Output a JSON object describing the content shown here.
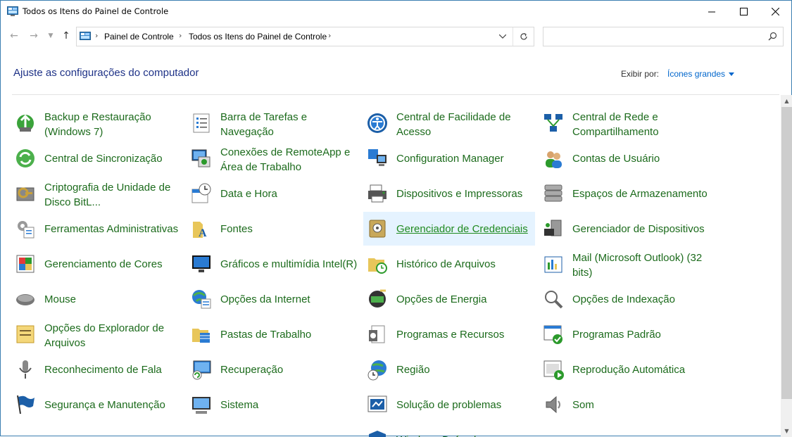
{
  "window": {
    "title": "Todos os Itens do Painel de Controle"
  },
  "address": {
    "crumbs": [
      "Painel de Controle",
      "Todos os Itens do Painel de Controle"
    ],
    "search_placeholder": ""
  },
  "header": {
    "title": "Ajuste as configurações do computador",
    "view_label": "Exibir por:",
    "view_value": "Ícones grandes"
  },
  "items": [
    {
      "label": "Backup e Restauração (Windows 7)",
      "icon": "backup-icon"
    },
    {
      "label": "Barra de Tarefas e Navegação",
      "icon": "taskbar-icon"
    },
    {
      "label": "Central de Facilidade de Acesso",
      "icon": "ease-of-access-icon"
    },
    {
      "label": "Central de Rede e Compartilhamento",
      "icon": "network-icon"
    },
    {
      "label": "Central de Sincronização",
      "icon": "sync-icon"
    },
    {
      "label": "Conexões de RemoteApp e Área de Trabalho",
      "icon": "remoteapp-icon"
    },
    {
      "label": "Configuration Manager",
      "icon": "config-manager-icon"
    },
    {
      "label": "Contas de Usuário",
      "icon": "users-icon"
    },
    {
      "label": "Criptografia de Unidade de Disco BitL...",
      "icon": "bitlocker-icon"
    },
    {
      "label": "Data e Hora",
      "icon": "clock-icon"
    },
    {
      "label": "Dispositivos e Impressoras",
      "icon": "printer-icon"
    },
    {
      "label": "Espaços de Armazenamento",
      "icon": "storage-icon"
    },
    {
      "label": "Ferramentas Administrativas",
      "icon": "admin-tools-icon"
    },
    {
      "label": "Fontes",
      "icon": "fonts-icon"
    },
    {
      "label": "Gerenciador de Credenciais",
      "icon": "credential-icon"
    },
    {
      "label": "Gerenciador de Dispositivos",
      "icon": "device-manager-icon"
    },
    {
      "label": "Gerenciamento de Cores",
      "icon": "color-icon"
    },
    {
      "label": "Gráficos e multimídia Intel(R)",
      "icon": "intel-graphics-icon"
    },
    {
      "label": "Histórico de Arquivos",
      "icon": "file-history-icon"
    },
    {
      "label": "Mail (Microsoft Outlook) (32 bits)",
      "icon": "mail-icon"
    },
    {
      "label": "Mouse",
      "icon": "mouse-icon"
    },
    {
      "label": "Opções da Internet",
      "icon": "internet-icon"
    },
    {
      "label": "Opções de Energia",
      "icon": "power-icon"
    },
    {
      "label": "Opções de Indexação",
      "icon": "indexing-icon"
    },
    {
      "label": "Opções do Explorador de Arquivos",
      "icon": "explorer-options-icon"
    },
    {
      "label": "Pastas de Trabalho",
      "icon": "work-folders-icon"
    },
    {
      "label": "Programas e Recursos",
      "icon": "programs-icon"
    },
    {
      "label": "Programas Padrão",
      "icon": "default-programs-icon"
    },
    {
      "label": "Reconhecimento de Fala",
      "icon": "microphone-icon"
    },
    {
      "label": "Recuperação",
      "icon": "recovery-icon"
    },
    {
      "label": "Região",
      "icon": "region-icon"
    },
    {
      "label": "Reprodução Automática",
      "icon": "autoplay-icon"
    },
    {
      "label": "Segurança e Manutenção",
      "icon": "flag-icon"
    },
    {
      "label": "Sistema",
      "icon": "system-icon"
    },
    {
      "label": "Solução de problemas",
      "icon": "troubleshoot-icon"
    },
    {
      "label": "Som",
      "icon": "speaker-icon"
    },
    {
      "label": "",
      "icon": ""
    },
    {
      "label": "",
      "icon": ""
    },
    {
      "label": "Windows Defender",
      "icon": "defender-icon"
    },
    {
      "label": "",
      "icon": ""
    }
  ],
  "hovered_item": "Gerenciador de Credenciais",
  "colors": {
    "link_green": "#1c6b1c",
    "title_blue": "#1e3287",
    "hover_bg": "#e5f3ff",
    "view_blue": "#0066cc"
  }
}
